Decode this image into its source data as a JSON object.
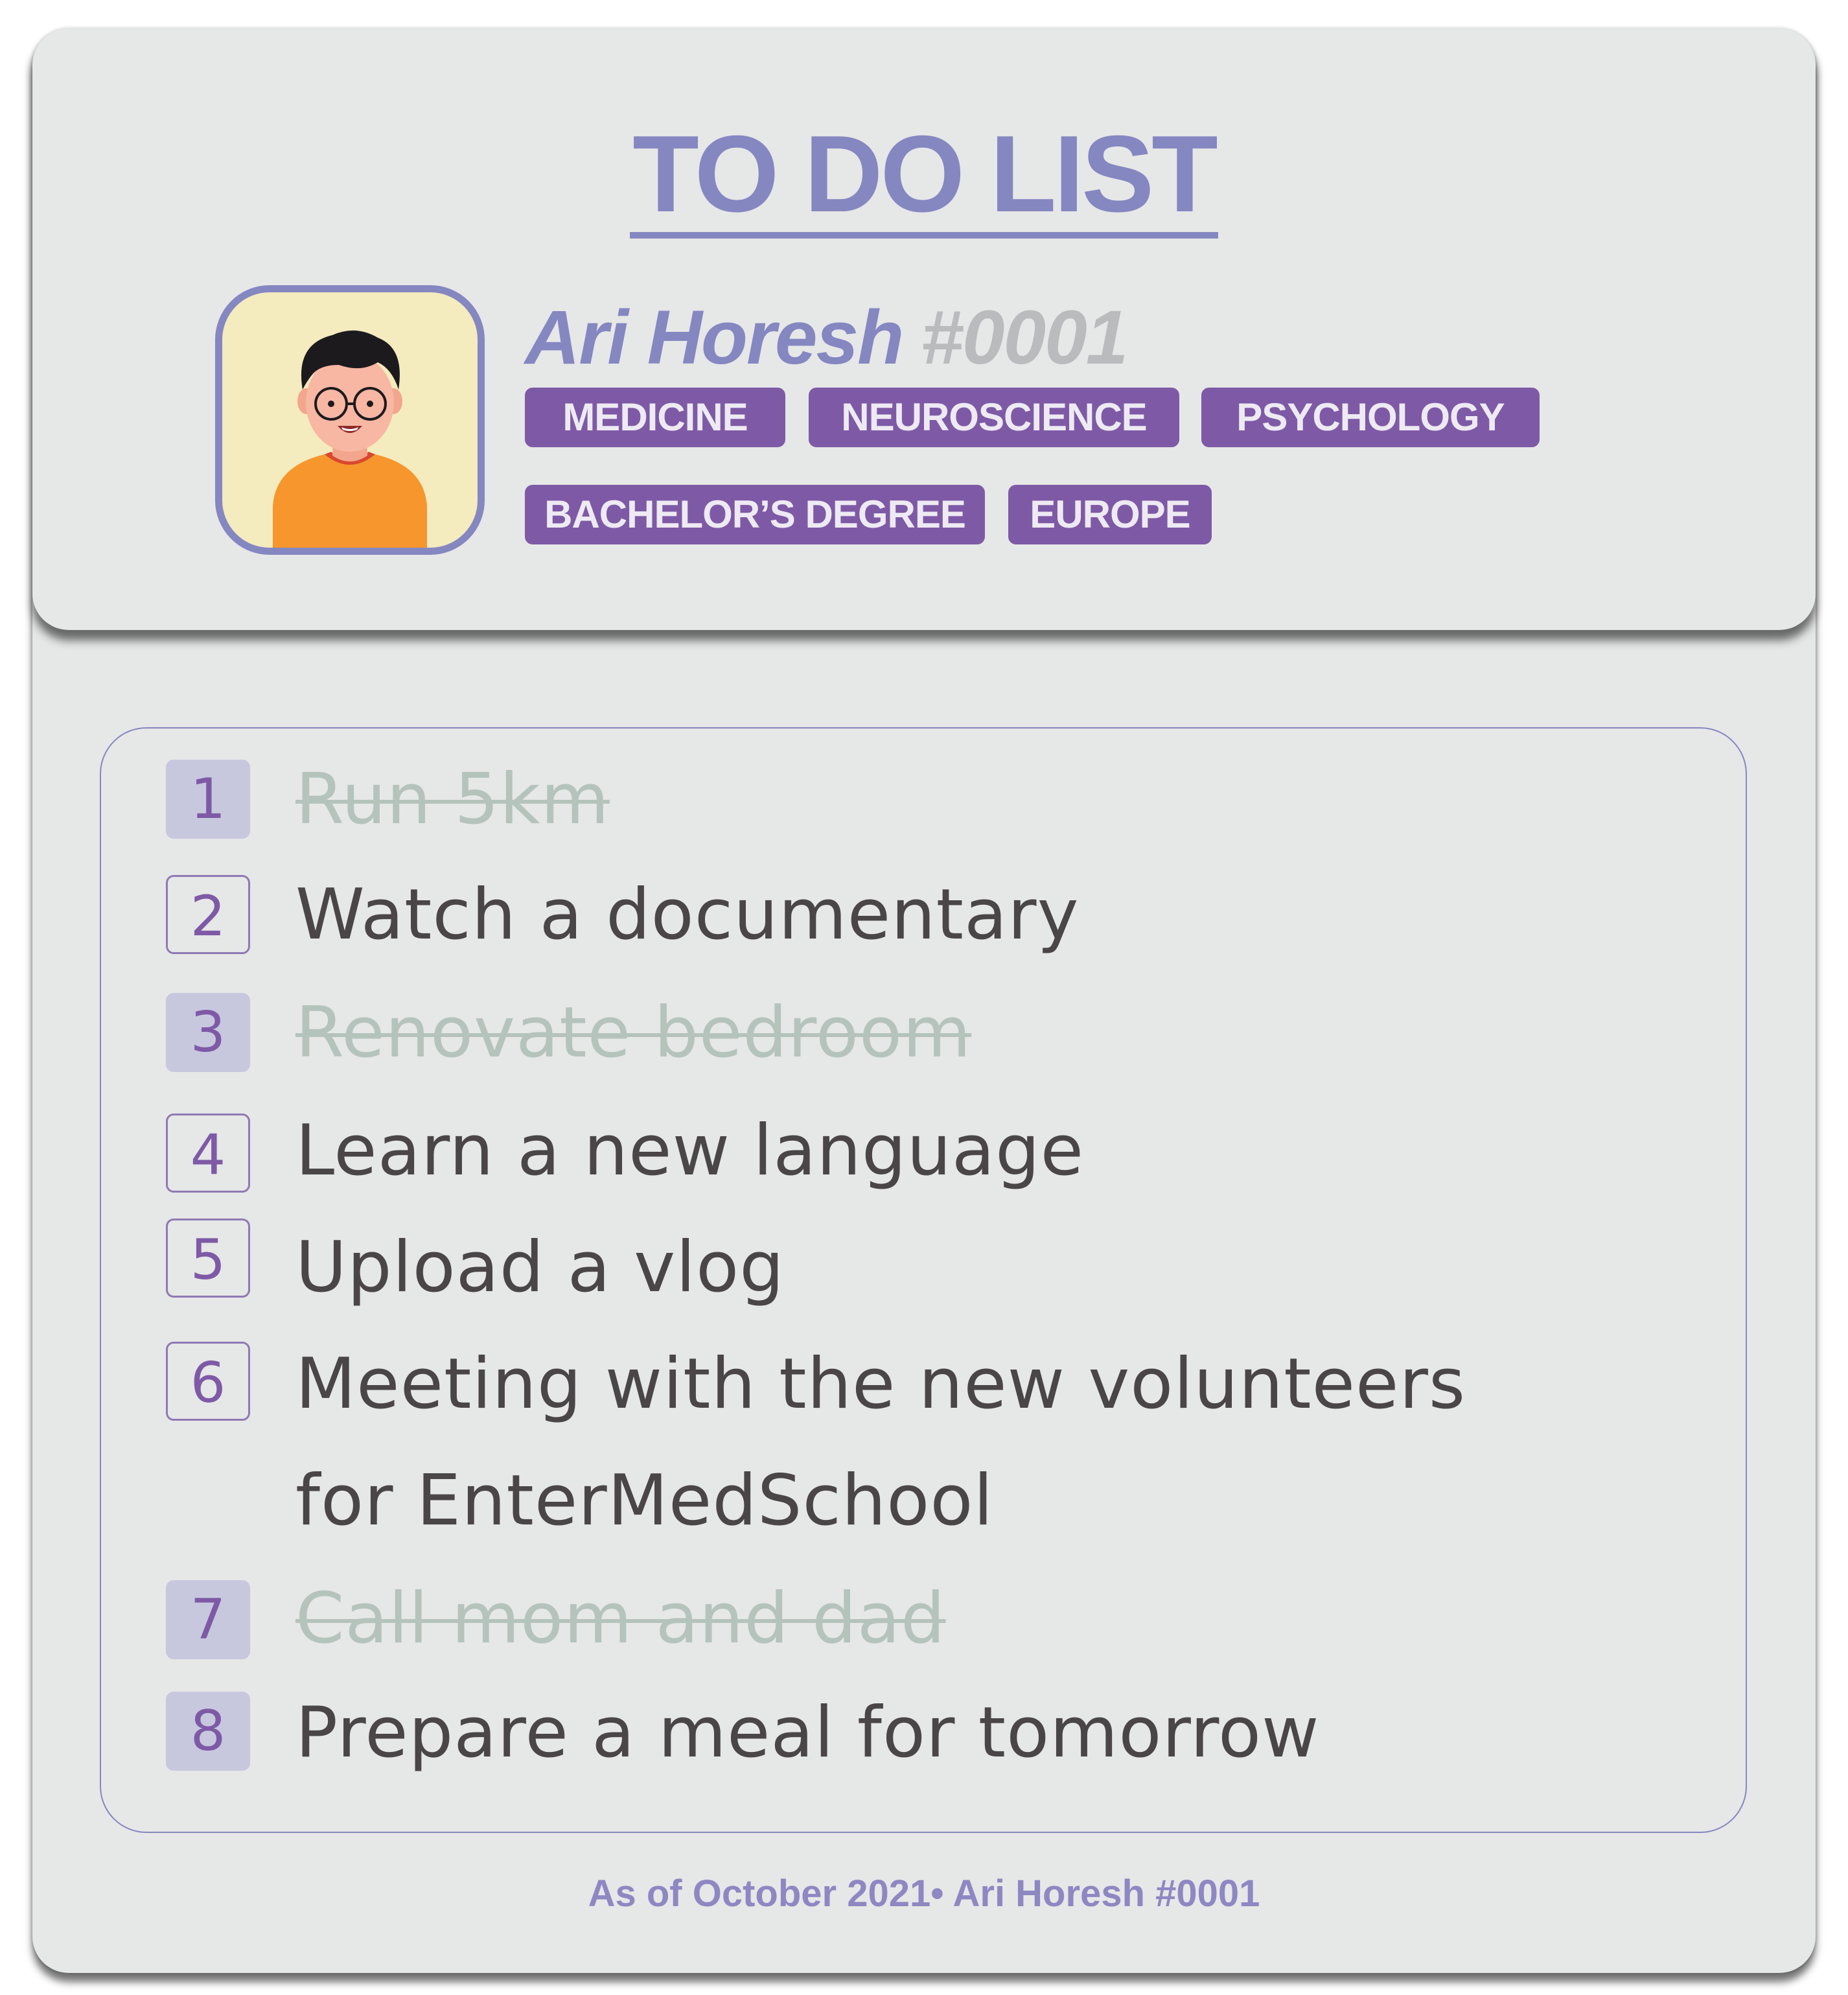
{
  "header": {
    "title": "TO DO LIST",
    "user_name": "Ari Horesh",
    "user_id": "#0001",
    "tags": [
      "MEDICINE",
      "NEUROSCIENCE",
      "PSYCHOLOGY",
      "BACHELOR’S DEGREE",
      "EUROPE"
    ]
  },
  "avatar": {
    "icon": "person-with-glasses-avatar"
  },
  "tasks": [
    {
      "number": "1",
      "text": "Run 5km",
      "done": true
    },
    {
      "number": "2",
      "text": "Watch a documentary",
      "done": false
    },
    {
      "number": "3",
      "text": "Renovate bedroom",
      "done": true
    },
    {
      "number": "4",
      "text": "Learn a new language",
      "done": false
    },
    {
      "number": "5",
      "text": "Upload a vlog",
      "done": false
    },
    {
      "number": "6",
      "text": "Meeting with the new volunteers",
      "text_line2": "for EnterMedSchool",
      "done": false
    },
    {
      "number": "7",
      "text": "Call mom and dad",
      "done": true
    },
    {
      "number": "8",
      "text": "Prepare a meal for tomorrow",
      "done": false
    }
  ],
  "footer": {
    "text": "As of October 2021• Ari Horesh #0001"
  },
  "colors": {
    "accent": "#8587c1",
    "tag_background": "#7e5aa6",
    "card_background": "#e6e7e7",
    "done_text": "#b5c3bd",
    "open_text": "#4a4648"
  }
}
